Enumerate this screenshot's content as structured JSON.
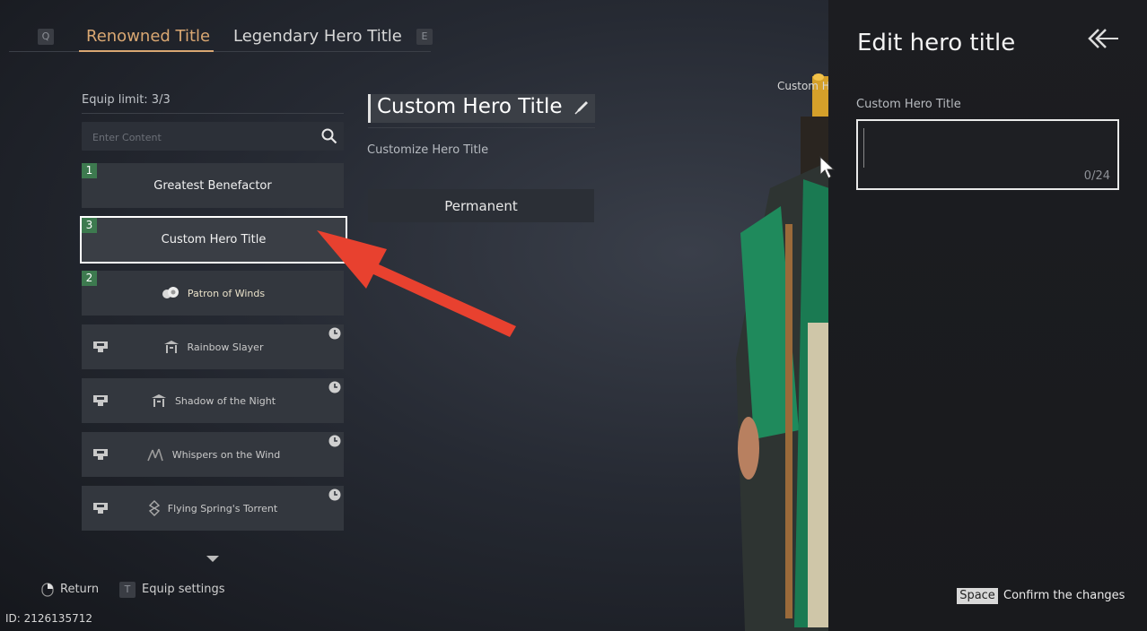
{
  "tabs": {
    "left_key": "Q",
    "right_key": "E",
    "items": [
      {
        "label": "Renowned Title",
        "active": true
      },
      {
        "label": "Legendary Hero Title",
        "active": false
      }
    ]
  },
  "list": {
    "equip_limit": "Equip limit: 3/3",
    "search_placeholder": "Enter Content",
    "items": [
      {
        "label": "Greatest Benefactor",
        "badge": "1"
      },
      {
        "label": "Custom Hero Title",
        "badge": "3",
        "selected": true
      },
      {
        "label": "Patron of Winds",
        "badge": "2"
      },
      {
        "label": "Rainbow Slayer",
        "locked": true
      },
      {
        "label": "Shadow of the Night",
        "locked": true
      },
      {
        "label": "Whispers on the Wind",
        "locked": true
      },
      {
        "label": "Flying Spring's Torrent",
        "locked": true
      }
    ]
  },
  "footer": {
    "return_label": "Return",
    "equip_key": "T",
    "equip_label": "Equip settings",
    "id_text": "ID: 2126135712"
  },
  "detail": {
    "title": "Custom Hero Title",
    "description": "Customize Hero Title",
    "duration": "Permanent"
  },
  "hero": {
    "label": "Custom Hero Title"
  },
  "panel": {
    "title": "Edit hero title",
    "field_label": "Custom Hero Title",
    "input_value": "",
    "counter": "0/24",
    "confirm_key": "Space",
    "confirm_label": "Confirm the changes"
  },
  "colors": {
    "accent": "#d9a772",
    "badge_green": "#3d7a4f",
    "annotation_red": "#e8412f"
  }
}
